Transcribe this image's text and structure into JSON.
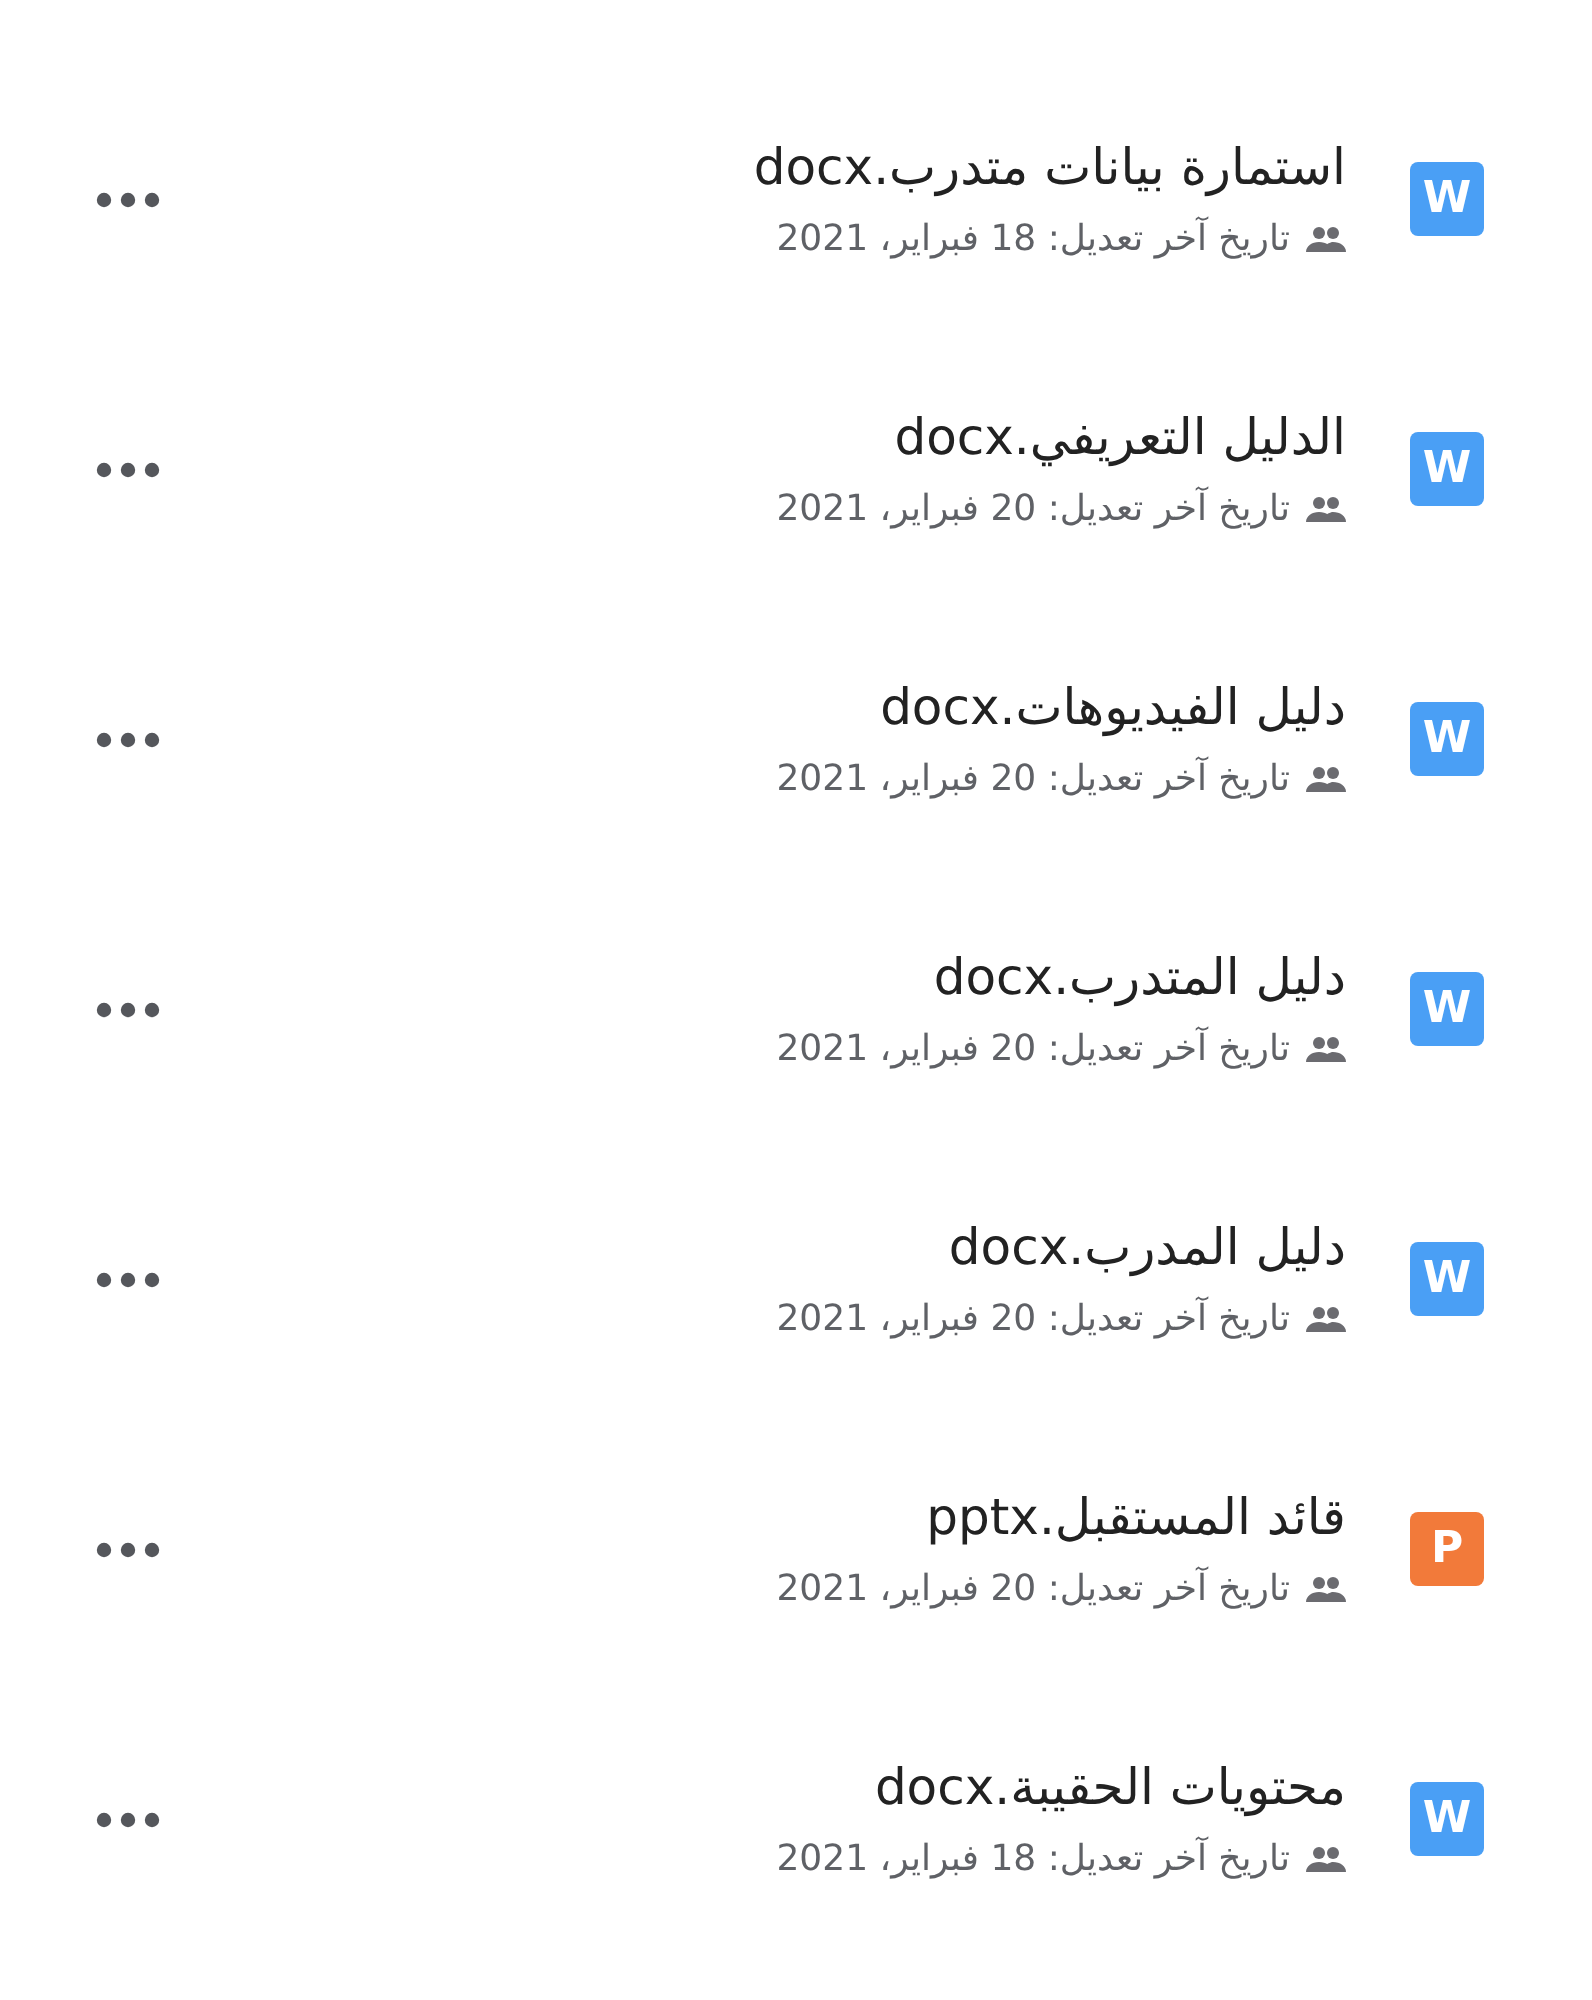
{
  "files": [
    {
      "kind": "word",
      "badge": "W",
      "name": "استمارة بيانات متدرب.docx",
      "modified": "تاريخ آخر تعديل: 18 فبراير، 2021"
    },
    {
      "kind": "word",
      "badge": "W",
      "name": "الدليل التعريفي.docx",
      "modified": "تاريخ آخر تعديل: 20 فبراير، 2021"
    },
    {
      "kind": "word",
      "badge": "W",
      "name": "دليل الفيديوهات.docx",
      "modified": "تاريخ آخر تعديل: 20 فبراير، 2021"
    },
    {
      "kind": "word",
      "badge": "W",
      "name": "دليل المتدرب.docx",
      "modified": "تاريخ آخر تعديل: 20 فبراير، 2021"
    },
    {
      "kind": "word",
      "badge": "W",
      "name": "دليل المدرب.docx",
      "modified": "تاريخ آخر تعديل: 20 فبراير، 2021"
    },
    {
      "kind": "powerpoint",
      "badge": "P",
      "name": "قائد المستقبل.pptx",
      "modified": "تاريخ آخر تعديل: 20 فبراير، 2021"
    },
    {
      "kind": "word",
      "badge": "W",
      "name": "محتويات الحقيبة.docx",
      "modified": "تاريخ آخر تعديل: 18 فبراير، 2021"
    }
  ]
}
